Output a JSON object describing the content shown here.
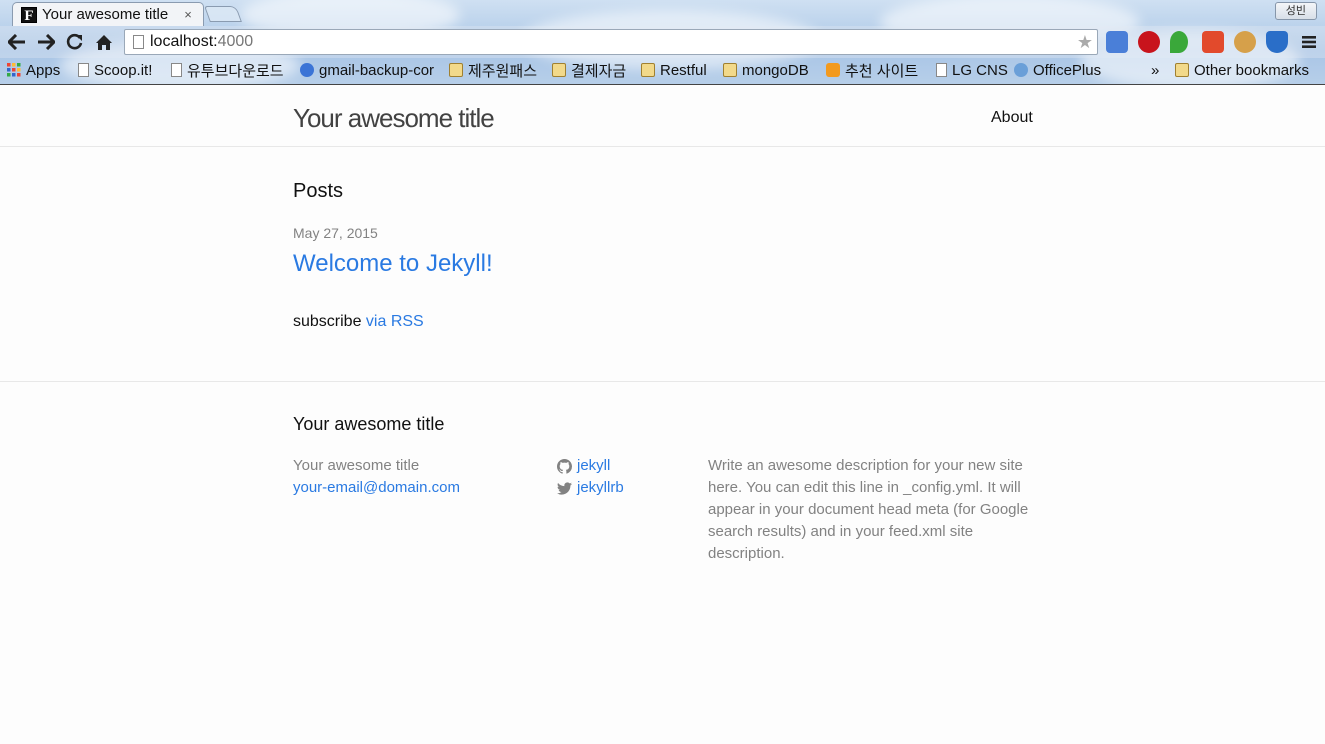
{
  "browser": {
    "tab_title": "Your awesome title",
    "tab_close": "×",
    "profile_name": "성빈",
    "url_host": "localhost:",
    "url_port": "4000",
    "bookmarks": [
      {
        "label": "Apps",
        "icon": "apps-grid-icon"
      },
      {
        "label": "Scoop.it!",
        "icon": "page-icon"
      },
      {
        "label": "유투브다운로드",
        "icon": "page-icon"
      },
      {
        "label": "gmail-backup-cor",
        "icon": "gmail-backup-icon"
      },
      {
        "label": "제주원패스",
        "icon": "folder-icon"
      },
      {
        "label": "결제자금",
        "icon": "folder-icon"
      },
      {
        "label": "Restful",
        "icon": "folder-icon"
      },
      {
        "label": "mongoDB",
        "icon": "folder-icon"
      },
      {
        "label": "추천 사이트",
        "icon": "blogger-icon"
      },
      {
        "label": "LG CNS",
        "icon": "page-icon"
      },
      {
        "label": "OfficePlus",
        "icon": "officeplus-icon"
      }
    ],
    "overflow": "»",
    "other_bookmarks": "Other bookmarks"
  },
  "site": {
    "title": "Your awesome title",
    "nav_about": "About"
  },
  "main": {
    "posts_heading": "Posts",
    "post": {
      "date": "May 27, 2015",
      "title": "Welcome to Jekyll!"
    },
    "subscribe_prefix": "subscribe ",
    "subscribe_link": "via RSS"
  },
  "footer": {
    "heading": "Your awesome title",
    "name": "Your awesome title",
    "email": "your-email@domain.com",
    "github_user": "jekyll",
    "twitter_user": "jekyllrb",
    "description": "Write an awesome description for your new site here. You can edit this line in _config.yml. It will appear in your document head meta (for Google search results) and in your feed.xml site description."
  },
  "colors": {
    "link": "#2a7ae2",
    "meta_grey": "#828282",
    "title_grey": "#424242"
  }
}
